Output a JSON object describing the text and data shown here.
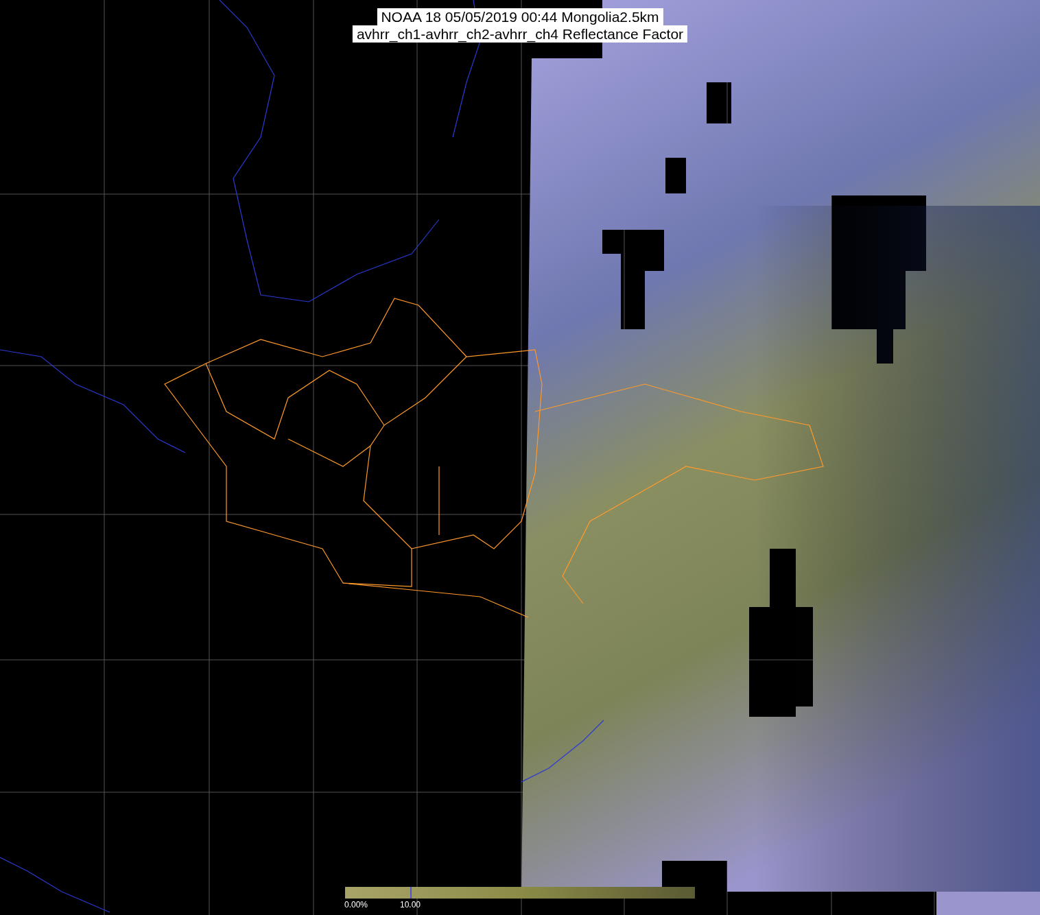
{
  "title": {
    "lines": [
      "NOAA 18 05/05/2019 00:44 Mongolia2.5km",
      "avhrr_ch1-avhrr_ch2-avhrr_ch4 Reflectance Factor"
    ]
  },
  "colorbar": {
    "labels": [
      "0.00%",
      "10.00"
    ]
  }
}
